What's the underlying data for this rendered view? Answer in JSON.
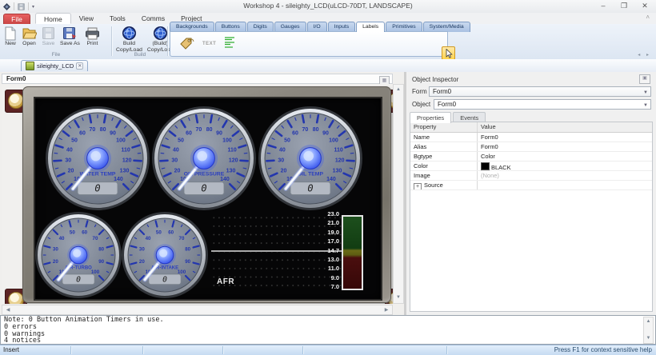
{
  "window": {
    "title": "Workshop 4 - sileighty_LCD(uLCD-70DT, LANDSCAPE)",
    "controls": {
      "minimize": "–",
      "maximize": "❐",
      "close": "✕"
    },
    "qat_caret": "▾",
    "ribbon_collapse": "˄"
  },
  "menu": {
    "file": "File",
    "tabs": [
      "Home",
      "View",
      "Tools",
      "Comms",
      "Project"
    ],
    "active": "Home"
  },
  "ribbon": {
    "file_group": {
      "label": "File",
      "buttons": [
        {
          "label": "New",
          "icon": "new-page-icon",
          "disabled": false
        },
        {
          "label": "Open",
          "icon": "open-folder-icon",
          "disabled": false
        },
        {
          "label": "Save",
          "icon": "save-icon",
          "disabled": true
        },
        {
          "label": "Save As",
          "icon": "save-as-icon",
          "disabled": false
        },
        {
          "label": "Print",
          "icon": "print-icon",
          "disabled": false
        }
      ]
    },
    "build_group": {
      "label": "Build",
      "buttons": [
        {
          "label": "Build\nCopy/Load",
          "icon": "build-globe-icon"
        },
        {
          "label": "(Build)\nCopy/Load",
          "icon": "build-globe-icon"
        }
      ]
    },
    "widget_palette": {
      "tabs": [
        "Backgrounds",
        "Buttons",
        "Digits",
        "Gauges",
        "I/O",
        "Inputs",
        "Labels",
        "Primitives",
        "System/Media"
      ],
      "active": "Labels",
      "items": [
        {
          "name": "tag-widget",
          "icon": "tag-icon"
        },
        {
          "name": "text-widget",
          "icon": "text-icon",
          "text": "TEXT"
        },
        {
          "name": "strings-widget",
          "icon": "strings-icon"
        }
      ]
    },
    "nav_arrows": "◂ ▸"
  },
  "document_tab": {
    "label": "sileighty_LCD",
    "close": "✕"
  },
  "form": {
    "title": "Form0"
  },
  "screen": {
    "gauges": [
      {
        "label": "WATER TEMP",
        "min": 10,
        "max": 140,
        "step": 10,
        "value": "0",
        "size": "large"
      },
      {
        "label": "OIL PRESSURE",
        "min": 10,
        "max": 140,
        "step": 10,
        "value": "0",
        "size": "large"
      },
      {
        "label": "OIL TEMP",
        "min": 10,
        "max": 140,
        "step": 10,
        "value": "0",
        "size": "large"
      },
      {
        "label": "AIR-TURBO",
        "min": 10,
        "max": 100,
        "step": 10,
        "value": "0",
        "size": "small"
      },
      {
        "label": "AIR-INTAKE",
        "min": 10,
        "max": 100,
        "step": 10,
        "value": "0",
        "size": "small"
      }
    ],
    "afr": {
      "label": "AFR",
      "scale": [
        "23.0",
        "21.0",
        "19.0",
        "17.0",
        "14.7",
        "13.0",
        "11.0",
        "9.0",
        "7.0"
      ],
      "line_value": "14.7",
      "bar_colors": {
        "rich_top": "#1d4f1d",
        "mid_stoich": "#6a6a16",
        "lean_bottom": "#4a0e0e"
      }
    }
  },
  "inspector": {
    "title": "Object Inspector",
    "form_label": "Form",
    "form_value": "Form0",
    "object_label": "Object",
    "object_value": "Form0",
    "tabs": [
      "Properties",
      "Events"
    ],
    "active_tab": "Properties",
    "grid": {
      "headers": [
        "Property",
        "Value"
      ],
      "rows": [
        {
          "property": "Name",
          "value": "Form0"
        },
        {
          "property": "Alias",
          "value": "Form0"
        },
        {
          "property": "Bgtype",
          "value": "Color"
        },
        {
          "property": "Color",
          "value": "BLACK",
          "swatch": "#000000"
        },
        {
          "property": "Image",
          "value": "(None)",
          "muted": true
        },
        {
          "property": "Source",
          "value": "",
          "expandable": true
        }
      ]
    }
  },
  "messages": {
    "lines": [
      "Note: 0 Button Animation Timers in use.",
      "0 errors",
      "0 warnings",
      "4 notices"
    ]
  },
  "status": {
    "left": "Insert",
    "right": "Press F1 for context sensitive help"
  },
  "colors": {
    "file_tab_red": "#d75050",
    "gauge_tick_blue": "#2336ae",
    "gauge_face": "#7d8593",
    "needle": "#dfe7f5",
    "hub_blue": "#2b47e8",
    "screen_black": "#060607",
    "statusbar_blue": "#c6dbf2",
    "cursor_tool_highlight": "#ffd34d"
  }
}
